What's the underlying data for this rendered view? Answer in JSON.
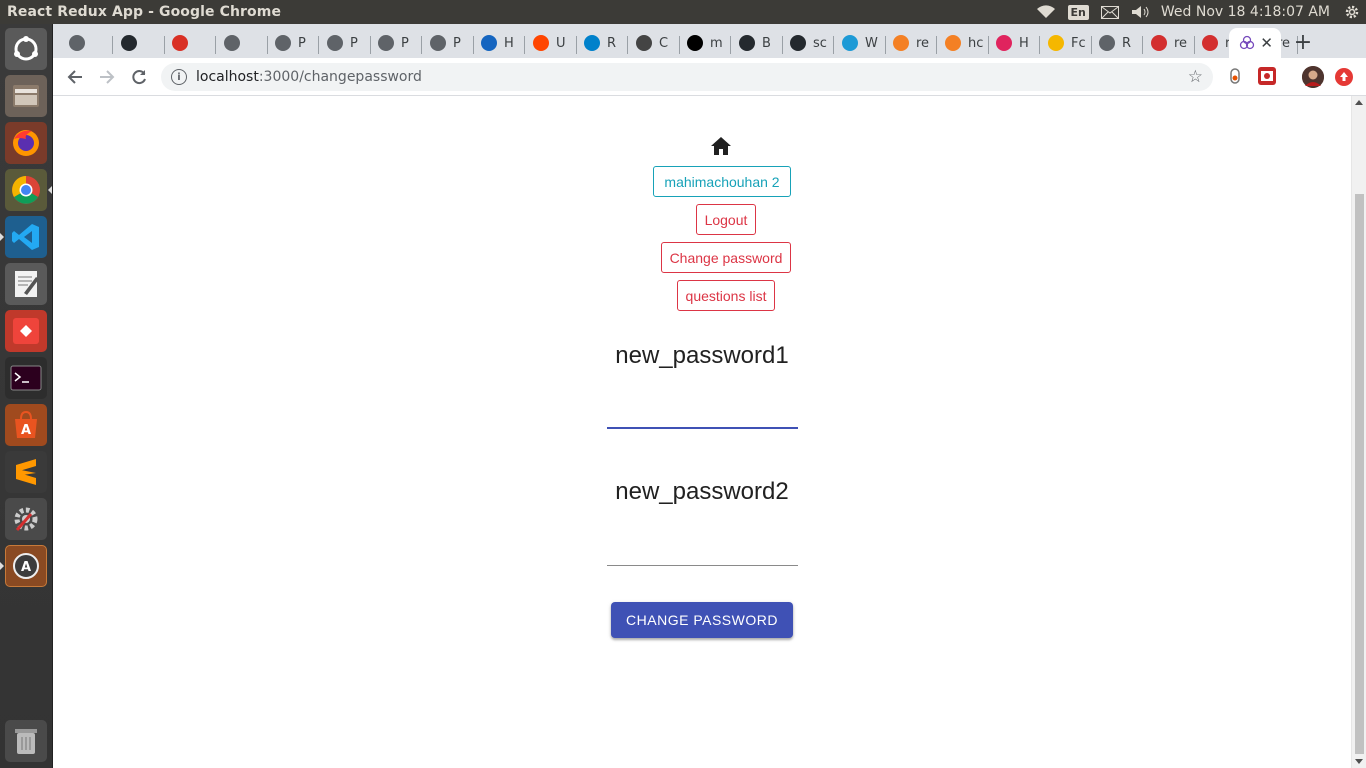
{
  "os": {
    "window_title": "React Redux App - Google Chrome",
    "keyboard_layout": "En",
    "clock": "Wed Nov 18  4:18:07 AM"
  },
  "browser": {
    "tabs": [
      {
        "label": "",
        "icon": "globe-icon",
        "color": "#5f6368"
      },
      {
        "label": "",
        "icon": "github-icon",
        "color": "#24292e"
      },
      {
        "label": "",
        "icon": "gmail-icon",
        "color": "#d93025"
      },
      {
        "label": "",
        "icon": "globe-icon",
        "color": "#5f6368"
      },
      {
        "label": "P",
        "icon": "globe-icon",
        "color": "#5f6368"
      },
      {
        "label": "P",
        "icon": "globe-icon",
        "color": "#5f6368"
      },
      {
        "label": "P",
        "icon": "globe-icon",
        "color": "#5f6368"
      },
      {
        "label": "P",
        "icon": "globe-icon",
        "color": "#5f6368"
      },
      {
        "label": "H",
        "icon": "monitor-icon",
        "color": "#1565c0"
      },
      {
        "label": "U",
        "icon": "reddit-icon",
        "color": "#ff4500"
      },
      {
        "label": "R",
        "icon": "mui-icon",
        "color": "#0081cb"
      },
      {
        "label": "C",
        "icon": "codesandbox-icon",
        "color": "#444"
      },
      {
        "label": "m",
        "icon": "medium-icon",
        "color": "#000"
      },
      {
        "label": "B",
        "icon": "github-icon",
        "color": "#24292e"
      },
      {
        "label": "sc",
        "icon": "github-icon",
        "color": "#24292e"
      },
      {
        "label": "W",
        "icon": "docker-icon",
        "color": "#1d9ad6"
      },
      {
        "label": "re",
        "icon": "stackoverflow-icon",
        "color": "#f48024"
      },
      {
        "label": "hc",
        "icon": "stackoverflow-icon",
        "color": "#f48024"
      },
      {
        "label": "H",
        "icon": "media-icon",
        "color": "#e0245e"
      },
      {
        "label": "Fc",
        "icon": "linux-icon",
        "color": "#f5b700"
      },
      {
        "label": "R",
        "icon": "globe-icon",
        "color": "#5f6368"
      },
      {
        "label": "re",
        "icon": "bookmark-icon",
        "color": "#d32f2f"
      },
      {
        "label": "re",
        "icon": "bookmark-icon",
        "color": "#d32f2f"
      },
      {
        "label": "re",
        "icon": "github-icon",
        "color": "#24292e"
      }
    ],
    "active_tab_icon": "redux-icon",
    "url_host": "localhost",
    "url_path": ":3000/changepassword"
  },
  "page": {
    "username": "mahimachouhan 2",
    "logout_label": "Logout",
    "change_password_label": "Change password",
    "questions_list_label": "questions list",
    "field1_label": "new_password1",
    "field1_value": "",
    "field2_label": "new_password2",
    "field2_value": "",
    "submit_label": "CHANGE PASSWORD"
  },
  "colors": {
    "primary": "#3f51b5",
    "info": "#17a2b8",
    "danger": "#dc3545"
  }
}
